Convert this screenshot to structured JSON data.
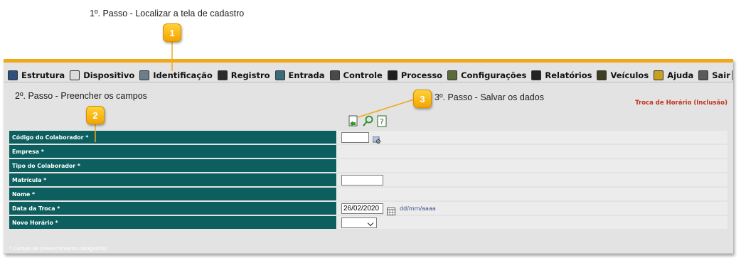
{
  "steps": {
    "step1": "1º. Passo - Localizar a tela de cadastro",
    "step2": "2º. Passo - Preencher os campos",
    "step3": "3º. Passo - Salvar os dados"
  },
  "callouts": {
    "c1": "1",
    "c2": "2",
    "c3": "3"
  },
  "menu": {
    "items": [
      {
        "label": "Estrutura",
        "icon": "structure-icon"
      },
      {
        "label": "Dispositivo",
        "icon": "device-icon"
      },
      {
        "label": "Identificação",
        "icon": "identification-icon"
      },
      {
        "label": "Registro",
        "icon": "register-icon"
      },
      {
        "label": "Entrada",
        "icon": "entry-icon"
      },
      {
        "label": "Controle",
        "icon": "control-icon"
      },
      {
        "label": "Processo",
        "icon": "process-icon"
      },
      {
        "label": "Configurações",
        "icon": "settings-icon"
      },
      {
        "label": "Relatórios",
        "icon": "reports-icon"
      },
      {
        "label": "Veículos",
        "icon": "vehicle-icon"
      },
      {
        "label": "Ajuda",
        "icon": "help-icon"
      },
      {
        "label": "Sair",
        "icon": "exit-icon"
      }
    ]
  },
  "page": {
    "title": "Troca de Horário (Inclusão)"
  },
  "toolbar": {
    "save_icon": "save-icon",
    "search_icon": "search-icon",
    "help_icon": "help-doc-icon"
  },
  "form": {
    "fields": {
      "codigo": {
        "label": "Código do Colaborador *",
        "value": ""
      },
      "empresa": {
        "label": "Empresa *"
      },
      "tipo": {
        "label": "Tipo do Colaborador *"
      },
      "matricula": {
        "label": "Matrícula *",
        "value": ""
      },
      "nome": {
        "label": "Nome *"
      },
      "data": {
        "label": "Data da Troca *",
        "value": "26/02/2020",
        "format": "dd/mm/aaaa"
      },
      "horario": {
        "label": "Novo Horário *",
        "value": ""
      }
    },
    "footnote": "* Campo de preenchimento obrigatório"
  },
  "colors": {
    "accent": "#f0a818",
    "label_bg": "#0d5f5f",
    "title": "#c0341b",
    "callout": "#f3a500"
  }
}
